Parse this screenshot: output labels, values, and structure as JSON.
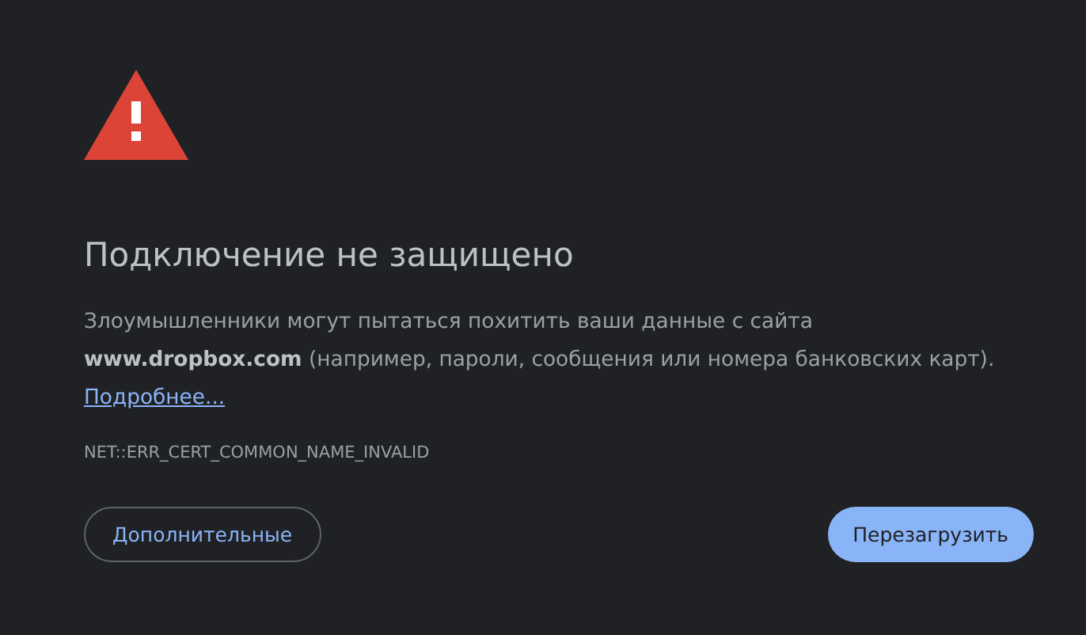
{
  "heading": "Подключение не защищено",
  "message": {
    "text": "Злоумышленники могут пытаться похитить ваши данные с сайта **www.dropbox.com** (например, пароли, сообщения или номера банковских карт).",
    "link": "Подробнее..."
  },
  "error_code": "NET::ERR_CERT_COMMON_NAME_INVALID",
  "buttons": [
    {
      "label": "Дополнительные",
      "kind": "secondary"
    },
    {
      "label": "Перезагрузить",
      "kind": "primary"
    }
  ]
}
